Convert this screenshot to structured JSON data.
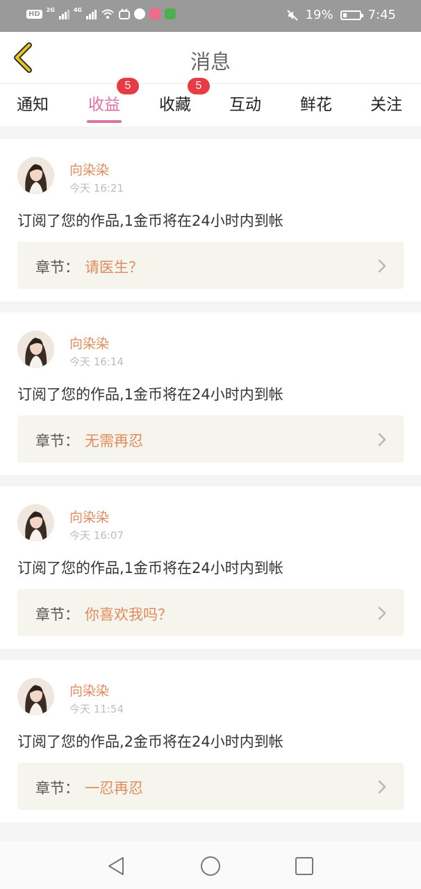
{
  "status_bar": {
    "hd": "HD",
    "net1": "2G",
    "net2": "4G",
    "battery_percent": "19%",
    "time": "7:45",
    "icons": [
      "wifi-icon",
      "app-icon-1",
      "app-icon-2",
      "app-icon-3",
      "app-icon-4",
      "mute-icon",
      "battery-icon"
    ]
  },
  "header": {
    "title": "消息",
    "back_icon": "chevron-left-icon",
    "accent": "#f0c419"
  },
  "tabs": [
    {
      "label": "通知",
      "badge": ""
    },
    {
      "label": "收益",
      "badge": "5",
      "active": true
    },
    {
      "label": "收藏",
      "badge": "5"
    },
    {
      "label": "互动",
      "badge": ""
    },
    {
      "label": "鲜花",
      "badge": ""
    },
    {
      "label": "关注",
      "badge": ""
    }
  ],
  "messages": [
    {
      "name": "向染染",
      "time": "今天 16:21",
      "text": "订阅了您的作品,1金币将在24小时内到帐",
      "chapter_label": "章节：",
      "chapter_title": "请医生？"
    },
    {
      "name": "向染染",
      "time": "今天 16:14",
      "text": "订阅了您的作品,1金币将在24小时内到帐",
      "chapter_label": "章节：",
      "chapter_title": "无需再忍"
    },
    {
      "name": "向染染",
      "time": "今天 16:07",
      "text": "订阅了您的作品,1金币将在24小时内到帐",
      "chapter_label": "章节：",
      "chapter_title": "你喜欢我吗？"
    },
    {
      "name": "向染染",
      "time": "今天 11:54",
      "text": "订阅了您的作品,2金币将在24小时内到帐",
      "chapter_label": "章节：",
      "chapter_title": "一忍再忍"
    }
  ],
  "colors": {
    "active_tab": "#e06fa3",
    "badge": "#e73c45",
    "name": "#e38a5c",
    "chapter_bg": "#f5f5ee"
  },
  "nav_icons": [
    "back-triangle-icon",
    "home-circle-icon",
    "recents-square-icon"
  ]
}
